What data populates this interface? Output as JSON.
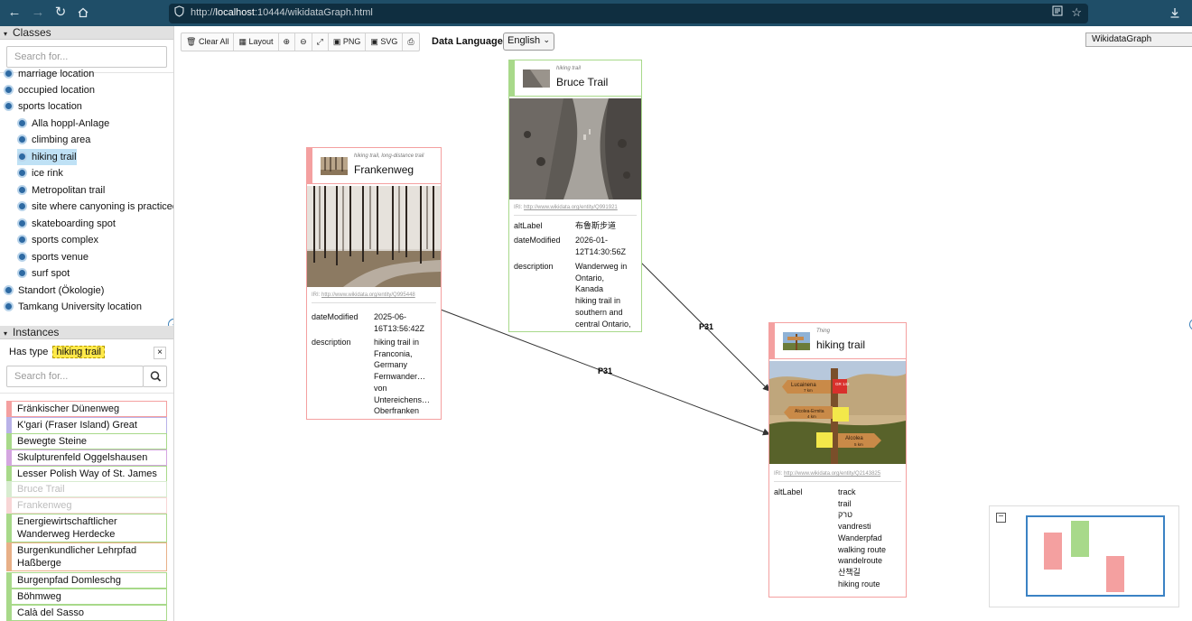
{
  "browser": {
    "url_prefix": "http://",
    "url_host": "localhost",
    "url_rest": ":10444/wikidataGraph.html"
  },
  "classes": {
    "header": "Classes",
    "search_placeholder": "Search for...",
    "items": [
      {
        "label": "marriage location",
        "level": 0
      },
      {
        "label": "occupied location",
        "level": 0
      },
      {
        "label": "sports location",
        "level": 0
      },
      {
        "label": "Alla hoppl-Anlage",
        "level": 1
      },
      {
        "label": "climbing area",
        "level": 1
      },
      {
        "label": "hiking trail",
        "level": 1,
        "selected": true
      },
      {
        "label": "ice rink",
        "level": 1
      },
      {
        "label": "Metropolitan trail",
        "level": 1
      },
      {
        "label": "site where canyoning is practiced",
        "level": 1
      },
      {
        "label": "skateboarding spot",
        "level": 1
      },
      {
        "label": "sports complex",
        "level": 1
      },
      {
        "label": "sports venue",
        "level": 1
      },
      {
        "label": "surf spot",
        "level": 1
      },
      {
        "label": "Standort (Ökologie)",
        "level": 0
      },
      {
        "label": "Tamkang University location",
        "level": 0
      }
    ]
  },
  "instances": {
    "header": "Instances",
    "filter_label": "Has type",
    "filter_value": "hiking trail",
    "filter_close": "×",
    "search_placeholder": "Search for...",
    "items": [
      {
        "label": "Fränkischer Dünenweg",
        "color": "#f4a0a0"
      },
      {
        "label": "K'gari (Fraser Island) Great Walk",
        "color": "#b9b2e8"
      },
      {
        "label": "Bewegte Steine",
        "color": "#a8d98a"
      },
      {
        "label": "Skulpturenfeld Oggelshausen",
        "color": "#d4a6e0"
      },
      {
        "label": "Lesser Polish Way of St. James",
        "color": "#a8d98a"
      },
      {
        "label": "Bruce Trail",
        "color": "#d8ecd0",
        "faded": true
      },
      {
        "label": "Frankenweg",
        "color": "#f8d6d6",
        "faded": true
      },
      {
        "label": "Energiewirtschaftlicher Wanderweg Herdecke",
        "color": "#a8d98a"
      },
      {
        "label": "Burgenkundlicher Lehrpfad Haßberge",
        "color": "#e8b088"
      },
      {
        "label": "Burgenpfad Domleschg",
        "color": "#a8d98a"
      },
      {
        "label": "Böhmweg",
        "color": "#a8d98a"
      },
      {
        "label": "Calà del Sasso",
        "color": "#a8d98a"
      }
    ]
  },
  "toolbar": {
    "clear_all": "Clear All",
    "layout": "Layout",
    "png": "PNG",
    "svg": "SVG",
    "language_label": "Data Language -",
    "language_value": "English",
    "graph_title": "WikidataGraph"
  },
  "nodes": {
    "frankenweg": {
      "type": "hiking trail, long-distance trail",
      "label": "Frankenweg",
      "color": "#f4a0a0",
      "iri_prefix": "IRI:",
      "iri": "http://www.wikidata.org/entity/Q995448",
      "props": [
        {
          "key": "dateModified",
          "value": "2025-06-\n16T13:56:42Z"
        },
        {
          "key": "description",
          "value": "hiking trail in\nFranconia,\nGermany\nFernwander…\nvon\nUntereichens…\nOberfranken"
        }
      ]
    },
    "bruce": {
      "type": "hiking trail",
      "label": "Bruce Trail",
      "color": "#a8d98a",
      "iri_prefix": "IRI:",
      "iri": "http://www.wikidata.org/entity/Q991921",
      "props": [
        {
          "key": "altLabel",
          "value": "布魯斯步道"
        },
        {
          "key": "dateModified",
          "value": "2026-01-\n12T14:30:56Z"
        },
        {
          "key": "description",
          "value": "Wanderweg in\nOntario,\nKanada\nhiking trail in\nsouthern and\ncentral Ontario,"
        }
      ]
    },
    "hiking": {
      "type": "Thing",
      "label": "hiking trail",
      "color": "#f4a0a0",
      "iri_prefix": "IRI:",
      "iri": "http://www.wikidata.org/entity/Q2143825",
      "props": [
        {
          "key": "altLabel",
          "value": "track\ntrail\nטרק\nvandresti\nWanderpfad\nwalking route\nwandelroute\n산책길\nhiking route"
        }
      ],
      "sign_texts": [
        "Lucainena",
        "7 km",
        "GR 142",
        "Alcolea-Ermita",
        "4 km",
        "Alcolea",
        "5 km"
      ]
    }
  },
  "edges": [
    {
      "label": "P31",
      "from": "frankenweg",
      "to": "hiking"
    },
    {
      "label": "P31",
      "from": "bruce",
      "to": "hiking"
    }
  ],
  "minimap": {
    "toggle": "−"
  }
}
